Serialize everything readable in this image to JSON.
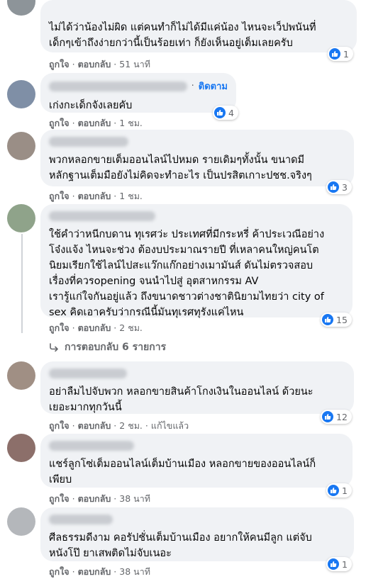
{
  "comments": [
    {
      "text": "ไม่ได้ว่าน้องไม่ผิด แต่คนทำก็ไม่ได้มีแค่น้อง ไหนจะเว็ปพนันที่\nเด็กๆเข้าถึงง่ายกว่านี้เป็นร้อยเท่า ก็ยังเห็นอยู่เต็มเลยครับ",
      "reactions": "1",
      "like": "ถูกใจ",
      "reply": "ตอบกลับ",
      "time": "51 นาที"
    },
    {
      "follow": "ติดตาม",
      "text": "เก่งกะเด็กจังเลยคับ",
      "reactions": "4",
      "like": "ถูกใจ",
      "reply": "ตอบกลับ",
      "time": "1 ชม."
    },
    {
      "text": "พวกหลอกขายเต็มออนไลน์ไปหมด รายเดิมๆทั้งนั้น ขนาดมี\nหลักฐานเต็มมือยังไม่คิดจะทำอะไร เป็นปรสิตเกาะปชช.จริงๆ",
      "reactions": "3",
      "like": "ถูกใจ",
      "reply": "ตอบกลับ",
      "time": "1 ชม."
    },
    {
      "text": "ใช้คำว่าหนีกบดาน ทุเรศว่ะ ประเทศที่มีกระหรี่ ค้าประเวณีอย่าง\nโจ๋งแจ้ง ไหนจะช่วง ต้องบประมาณรายปี ที่เหลาคนใหญ่คนโต\nนิยมเรียกใช้ไลน์ไปสะแว๊กแก๊กอย่างเมามันส์ ดันไม่ตรวจสอบ\nเรื่องที่ควรopening จนนำไปสู่ อุตสาหกรรม AV\nเรารู้แก่ใจกันอยู่แล้ว ถึงขนาดชาวต่างชาตินิยามไทยว่า city of\nsex คิดเอาครับว่ากรณีนี้มันทุเรศทุรังแค่ไหน",
      "reactions": "15",
      "like": "ถูกใจ",
      "reply": "ตอบกลับ",
      "time": "2 ชม.",
      "replies_label": "การตอบกลับ 6 รายการ"
    },
    {
      "text": "อย่าลืมไปจับพวก หลอกขายสินค้าโกงเงินในออนไลน์ ด้วยนะ\nเยอะมากทุกวันนี้",
      "reactions": "12",
      "like": "ถูกใจ",
      "reply": "ตอบกลับ",
      "time": "2 ชม.",
      "edited": "แก้ไขแล้ว"
    },
    {
      "text": "แชร์ลูกโซ่เต็มออนไลน์เต็มบ้านเมือง หลอกขายของออนไลน์ก็\nเพียบ",
      "reactions": "1",
      "like": "ถูกใจ",
      "reply": "ตอบกลับ",
      "time": "38 นาที"
    },
    {
      "text": "ศีลธรรมดีงาม คอรัปชั่นเต็มบ้านเมือง อยากให้คนมีลูก แต่จับ\nหนังโป๊ ยาเสพติดไม่จับเนอะ",
      "reactions": "1",
      "like": "ถูกใจ",
      "reply": "ตอบกลับ",
      "time": "38 นาที"
    }
  ],
  "colors": {
    "bubble": "#f0f2f5",
    "like_blue": "#1877f2",
    "meta_gray": "#65676b"
  },
  "icons": {
    "like": "thumbs-up-icon",
    "reply_arrow": "reply-arrow-icon"
  }
}
